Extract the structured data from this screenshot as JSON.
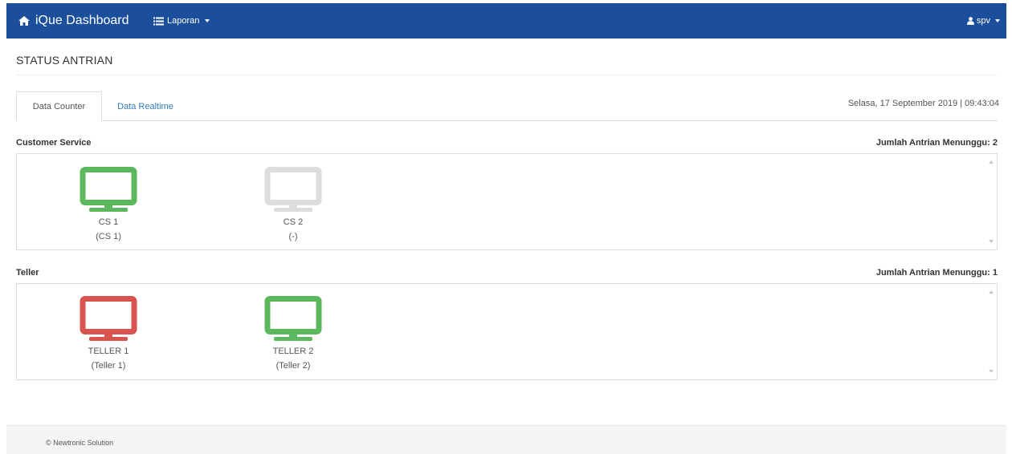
{
  "navbar": {
    "brand": "iQue Dashboard",
    "menu_label": "Laporan",
    "user_label": "spv",
    "bg_color": "#1b4f9c"
  },
  "page": {
    "title": "STATUS ANTRIAN",
    "datetime": "Selasa, 17 September 2019 | 09:43:04"
  },
  "tabs": [
    {
      "label": "Data Counter",
      "active": true
    },
    {
      "label": "Data Realtime",
      "active": false
    }
  ],
  "sections": [
    {
      "title": "Customer Service",
      "queue_label": "Jumlah Antrian Menunggu: 2",
      "counters": [
        {
          "name": "CS 1",
          "sub": "(CS 1)",
          "status_color": "#5cb85c"
        },
        {
          "name": "CS 2",
          "sub": "(-)",
          "status_color": "#dddddd"
        }
      ]
    },
    {
      "title": "Teller",
      "queue_label": "Jumlah Antrian Menunggu: 1",
      "counters": [
        {
          "name": "TELLER 1",
          "sub": "(Teller 1)",
          "status_color": "#d9534f"
        },
        {
          "name": "TELLER 2",
          "sub": "(Teller 2)",
          "status_color": "#5cb85c"
        }
      ]
    }
  ],
  "footer": {
    "text": "© Newtronic Solution"
  }
}
